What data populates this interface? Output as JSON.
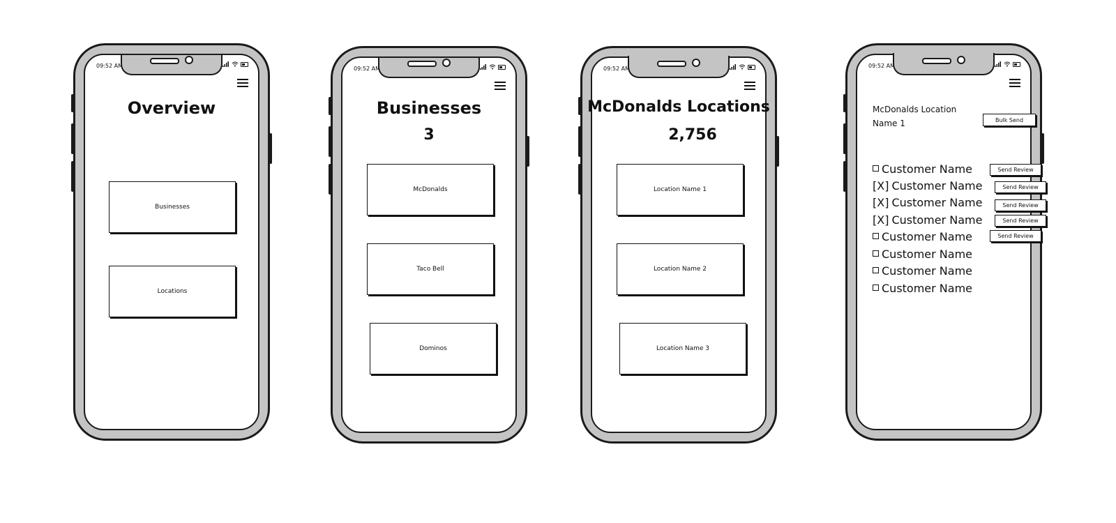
{
  "status_time": "09:52 AM",
  "screens": {
    "overview": {
      "title": "Overview",
      "buttons": [
        "Businesses",
        "Locations"
      ]
    },
    "businesses": {
      "title": "Businesses",
      "count": "3",
      "items": [
        "McDonalds",
        "Taco Bell",
        "Dominos"
      ]
    },
    "locations": {
      "title": "McDonalds Locations",
      "count": "2,756",
      "items": [
        "Location Name 1",
        "Location Name 2",
        "Location Name 3"
      ]
    },
    "location_detail": {
      "title": "McDonalds Location Name 1",
      "bulk_send_label": "Bulk Send",
      "send_review_label": "Send Review",
      "customers": [
        {
          "marker": "",
          "name": "Customer Name",
          "checked": false,
          "has_send": true
        },
        {
          "marker": "[X]",
          "name": "Customer Name",
          "checked": true,
          "has_send": true
        },
        {
          "marker": "[X]",
          "name": "Customer Name",
          "checked": true,
          "has_send": true
        },
        {
          "marker": "[X]",
          "name": "Customer Name",
          "checked": true,
          "has_send": true
        },
        {
          "marker": "",
          "name": "Customer Name",
          "checked": false,
          "has_send": true
        },
        {
          "marker": "",
          "name": "Customer Name",
          "checked": false,
          "has_send": false
        },
        {
          "marker": "",
          "name": "Customer Name",
          "checked": false,
          "has_send": false
        },
        {
          "marker": "",
          "name": "Customer Name",
          "checked": false,
          "has_send": false
        }
      ]
    }
  }
}
